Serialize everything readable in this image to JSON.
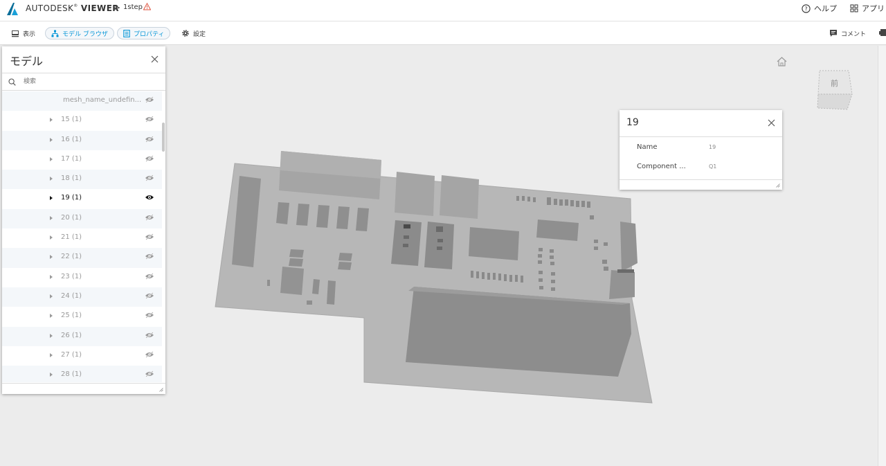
{
  "header": {
    "brand_light": "AUTODESK",
    "brand_bold": "VIEWER",
    "breadcrumb_chevron": ">",
    "file_name": "1step",
    "help_label": "ヘルプ",
    "apps_label": "アプリ"
  },
  "toolbar": {
    "view_label": "表示",
    "model_browser_label": "モデル ブラウザ",
    "properties_label": "プロパティ",
    "settings_label": "設定",
    "comments_label": "コメント"
  },
  "model_panel": {
    "title": "モデル",
    "search_placeholder": "検索",
    "rows": [
      {
        "label": "mesh_name_undefin...",
        "kind": "mesh",
        "visible": false
      },
      {
        "label": "15 (1)",
        "visible": false
      },
      {
        "label": "16 (1)",
        "visible": false
      },
      {
        "label": "17 (1)",
        "visible": false
      },
      {
        "label": "18 (1)",
        "visible": false
      },
      {
        "label": "19 (1)",
        "visible": true,
        "selected": true
      },
      {
        "label": "20 (1)",
        "visible": false
      },
      {
        "label": "21 (1)",
        "visible": false
      },
      {
        "label": "22 (1)",
        "visible": false
      },
      {
        "label": "23 (1)",
        "visible": false
      },
      {
        "label": "24 (1)",
        "visible": false
      },
      {
        "label": "25 (1)",
        "visible": false
      },
      {
        "label": "26 (1)",
        "visible": false
      },
      {
        "label": "27 (1)",
        "visible": false
      },
      {
        "label": "28 (1)",
        "visible": false
      }
    ]
  },
  "property_panel": {
    "title": "19",
    "rows": [
      {
        "key": "Name",
        "value": "19"
      },
      {
        "key": "Component ...",
        "value": "Q1"
      }
    ]
  },
  "viewcube": {
    "face_label": "前"
  },
  "colors": {
    "accent": "#0696d7",
    "canvas_bg": "#ececec",
    "row_alt": "#f4f7fa",
    "model_gray": "#b3b3b3"
  }
}
